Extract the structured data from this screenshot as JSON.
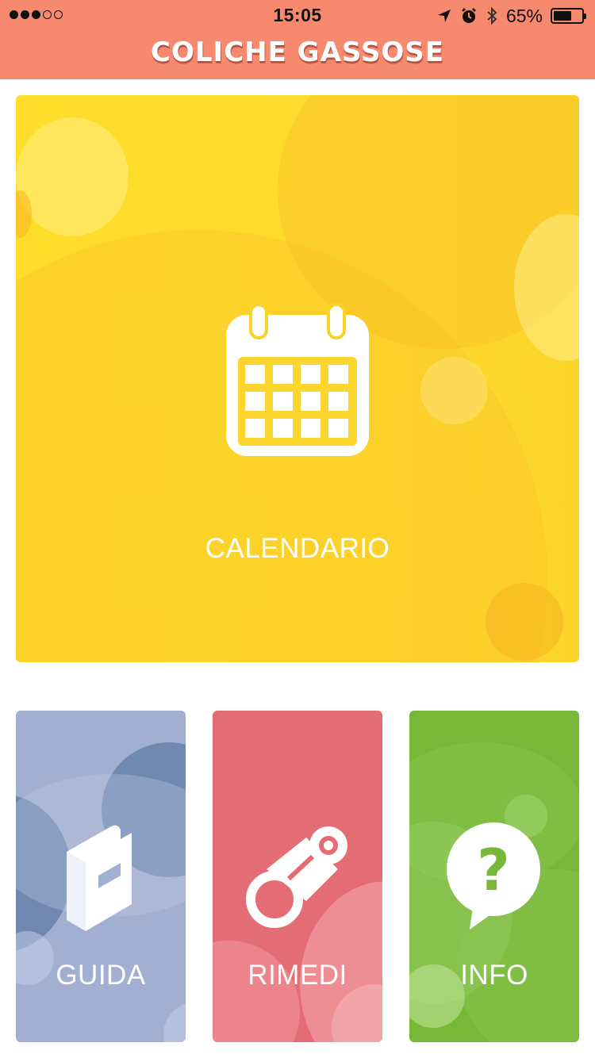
{
  "status_bar": {
    "time": "15:05",
    "battery": "65%",
    "battery_level": 0.65,
    "icons": [
      "signal-dots",
      "location-arrow-icon",
      "alarm-icon",
      "bluetooth-icon",
      "battery-icon"
    ]
  },
  "header": {
    "title": "COLICHE GASSOSE",
    "background": "#f7896e"
  },
  "tiles": {
    "calendar": {
      "label": "CALENDARIO",
      "icon": "calendar-icon",
      "color": "#ffdd2b"
    },
    "guida": {
      "label": "GUIDA",
      "icon": "book-icon",
      "color": "#a3afd0"
    },
    "rimedi": {
      "label": "RIMEDI",
      "icon": "pacifier-icon",
      "color": "#e46c74"
    },
    "info": {
      "label": "INFO",
      "icon": "question-bubble-icon",
      "color": "#78b838"
    }
  }
}
